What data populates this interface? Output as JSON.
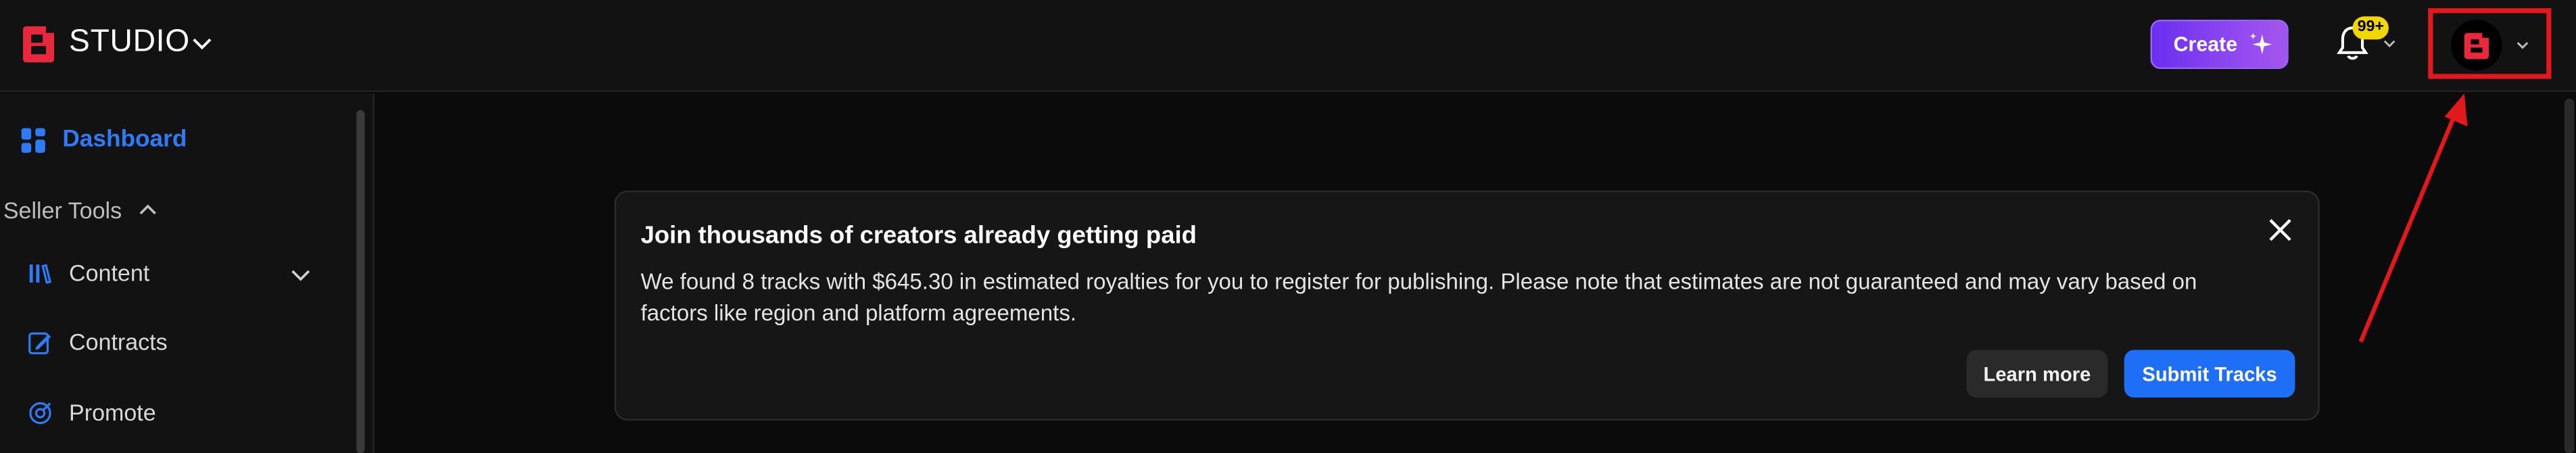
{
  "header": {
    "brand": "STUDIO",
    "create_label": "Create",
    "notification_count": "99+"
  },
  "sidebar": {
    "dashboard_label": "Dashboard",
    "section_label": "Seller Tools",
    "items": [
      {
        "label": "Content",
        "icon": "library-icon"
      },
      {
        "label": "Contracts",
        "icon": "contract-edit-icon"
      },
      {
        "label": "Promote",
        "icon": "promote-icon"
      }
    ]
  },
  "banner": {
    "title": "Join thousands of creators already getting paid",
    "text": "We found 8 tracks with $645.30 in estimated royalties for you to register for publishing. Please note that estimates are not guaranteed and may vary based on factors like region and platform agreements.",
    "learn_more": "Learn more",
    "submit": "Submit Tracks"
  },
  "colors": {
    "accent": "#2f7bf5",
    "brand_red": "#e8283d",
    "create_gradient_start": "#6b2ff0",
    "annotation_red": "#e0191d",
    "badge_yellow": "#f2d600"
  }
}
